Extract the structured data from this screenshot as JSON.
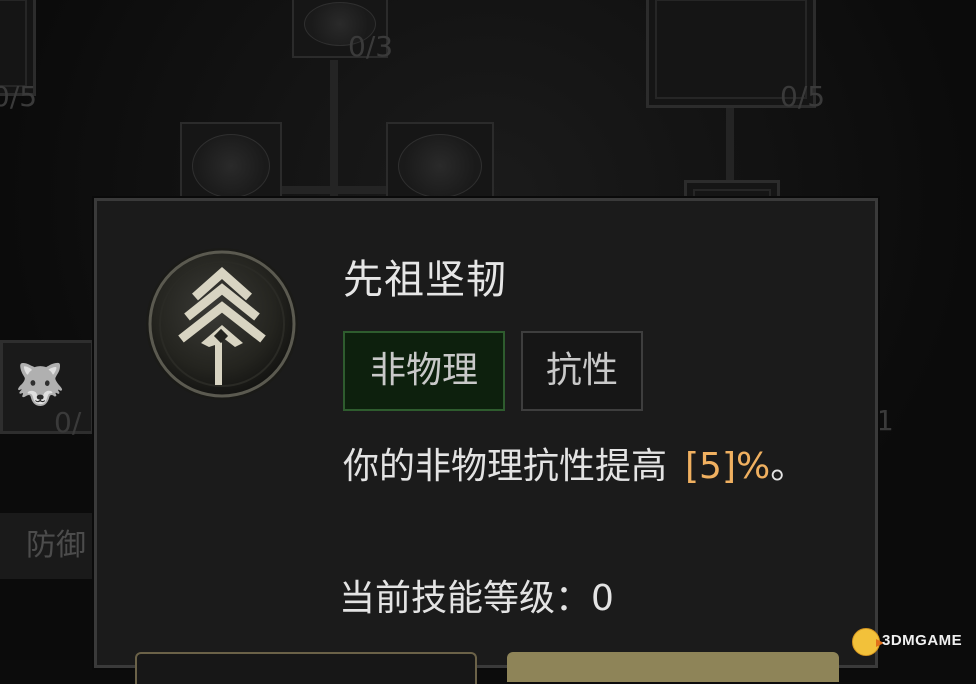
{
  "background": {
    "node_counts": [
      "0/3",
      "0/5",
      "0/5"
    ],
    "partial_counts": [
      "0/",
      "1"
    ],
    "side_label": "防御"
  },
  "tooltip": {
    "title": "先祖坚韧",
    "tags": [
      "非物理",
      "抗性"
    ],
    "description_prefix": "你的非物理抗性提高",
    "description_value": "[5]%",
    "description_suffix": "。",
    "level_label": "当前技能等级：",
    "level_value": "0"
  },
  "watermark": {
    "text": "3DMGAME"
  },
  "colors": {
    "value_highlight": "#f0b060",
    "tag_green_bg": "#0d200d",
    "tag_green_border": "#2e5c2e",
    "panel_bg": "#1b1b1b",
    "button_gold": "#8e8458"
  }
}
